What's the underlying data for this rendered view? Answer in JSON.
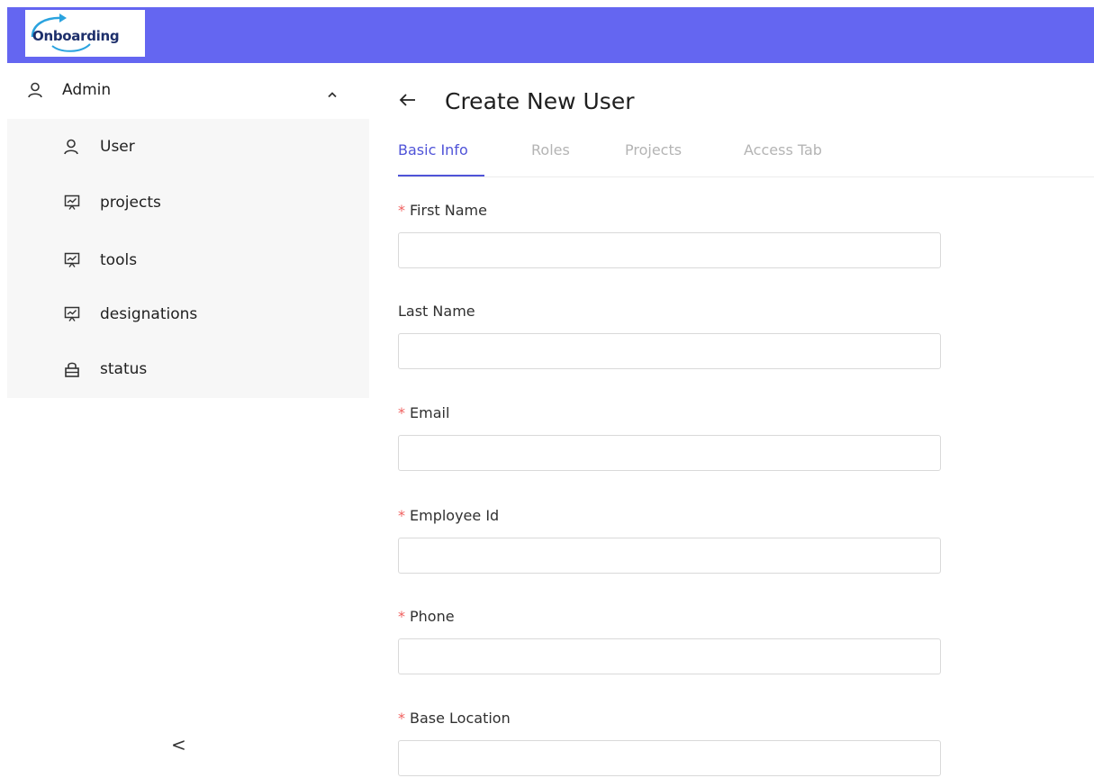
{
  "app": {
    "logo_text": "Onboarding",
    "brand_color": "#6466f1"
  },
  "sidebar": {
    "group": {
      "label": "Admin",
      "icon": "user-icon",
      "expanded": true
    },
    "items": [
      {
        "label": "User",
        "icon": "user-icon"
      },
      {
        "label": "projects",
        "icon": "presentation-icon"
      },
      {
        "label": "tools",
        "icon": "presentation-icon"
      },
      {
        "label": "designations",
        "icon": "presentation-icon"
      },
      {
        "label": "status",
        "icon": "lock-icon"
      }
    ],
    "collapse_label": "<"
  },
  "page": {
    "title": "Create New User"
  },
  "tabs": [
    {
      "label": "Basic Info",
      "active": true
    },
    {
      "label": "Roles",
      "active": false
    },
    {
      "label": "Projects",
      "active": false
    },
    {
      "label": "Access Tab",
      "active": false
    }
  ],
  "form": {
    "required_mark": "*",
    "fields": [
      {
        "label": "First Name",
        "required": true,
        "value": ""
      },
      {
        "label": "Last Name",
        "required": false,
        "value": ""
      },
      {
        "label": "Email",
        "required": true,
        "value": ""
      },
      {
        "label": "Employee Id",
        "required": true,
        "value": ""
      },
      {
        "label": "Phone",
        "required": true,
        "value": ""
      },
      {
        "label": "Base Location",
        "required": true,
        "value": ""
      }
    ]
  },
  "colors": {
    "accent": "#4f53d8",
    "required": "#f0605f",
    "submenu_bg": "#f7f7f7"
  }
}
